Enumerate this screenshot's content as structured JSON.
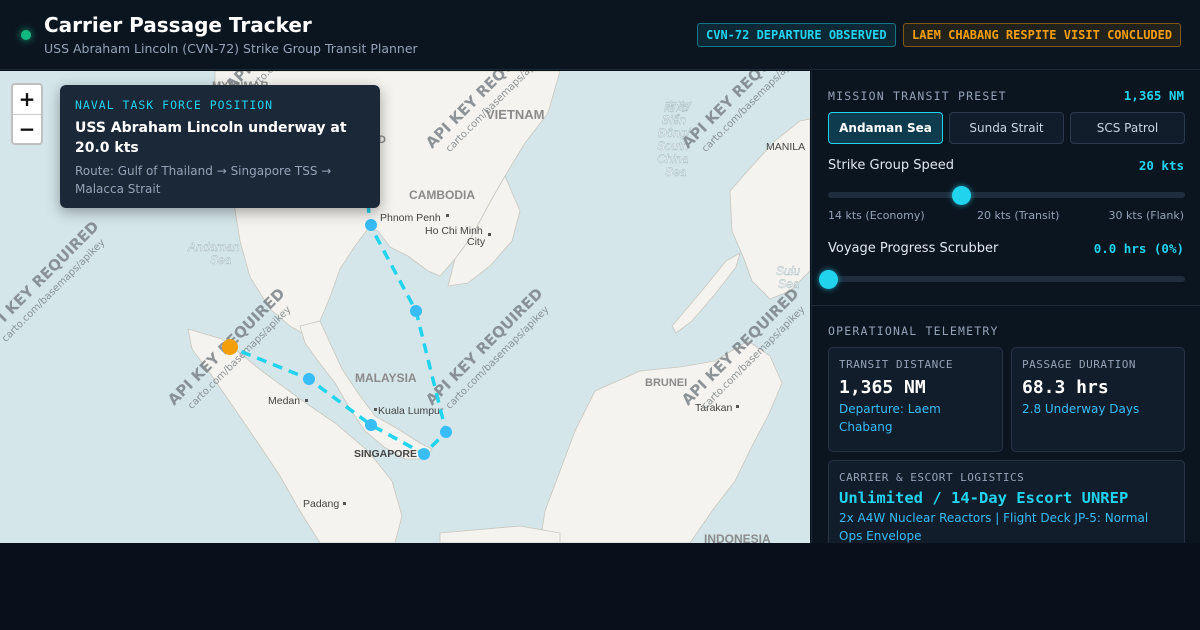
{
  "header": {
    "title": "Carrier Passage Tracker",
    "subtitle": "USS Abraham Lincoln (CVN-72) Strike Group Transit Planner",
    "badges": [
      {
        "label": "CVN-72 DEPARTURE OBSERVED",
        "color": "#22d3ee"
      },
      {
        "label": "LAEM CHABANG RESPITE VISIT CONCLUDED",
        "color": "#f59e0b"
      }
    ]
  },
  "map": {
    "zoom_in": "+",
    "zoom_out": "−",
    "labels": {
      "vietnam": "VIETNAM",
      "myanmar": "MYANMAR",
      "cambodia": "CAMBODIA",
      "phnom_penh": "Phnom Penh",
      "ho_chi_minh_1": "Ho Chi Minh",
      "ho_chi_minh_2": "City",
      "andaman_1": "Andaman",
      "andaman_2": "Sea",
      "malaysia": "MALAYSIA",
      "medan": "Medan",
      "kuala_lumpur": "Kuala Lumpur",
      "singapore": "SINGAPORE",
      "padang": "Padang",
      "brunei": "BRUNEI",
      "tarakan": "Tarakan",
      "indonesia": "INDONESIA",
      "manila": "MANILA",
      "scs_1": "南海/",
      "scs_2": "Biển",
      "scs_3": "Đông/",
      "scs_4": "South",
      "scs_5": "China",
      "scs_6": "Sea",
      "sulu_1": "Sulu",
      "sulu_2": "Sea",
      "d_fragment": "D"
    },
    "watermark_text": "API KEY REQUIRED",
    "watermark_sub": "carto.com/basemaps/apikey",
    "popup": {
      "kicker": "NAVAL TASK FORCE POSITION",
      "title": "USS Abraham Lincoln underway at 20.0 kts",
      "route": "Route: Gulf of Thailand → Singapore TSS → Malacca Strait"
    },
    "colors": {
      "route": "#22d3ee",
      "waypoint": "#38bdf8",
      "carrier": "#f59e0b",
      "water": "#d4e6ea",
      "land": "#f4f3ef"
    }
  },
  "panel": {
    "preset": {
      "label": "MISSION TRANSIT PRESET",
      "distance": "1,365 NM",
      "options": [
        "Andaman Sea",
        "Sunda Strait",
        "SCS Patrol"
      ],
      "active": "Andaman Sea"
    },
    "speed": {
      "label": "Strike Group Speed",
      "value": "20 kts",
      "min_kts": 14,
      "max_kts": 30,
      "current_kts": 20,
      "ticks": [
        "14 kts (Economy)",
        "20 kts (Transit)",
        "30 kts (Flank)"
      ]
    },
    "progress": {
      "label": "Voyage Progress Scrubber",
      "value": "0.0 hrs (0%)",
      "fraction": 0
    },
    "telemetry": {
      "label": "OPERATIONAL TELEMETRY",
      "distance": {
        "title": "TRANSIT DISTANCE",
        "value": "1,365 NM",
        "sub": "Departure: Laem Chabang"
      },
      "duration": {
        "title": "PASSAGE DURATION",
        "value": "68.3 hrs",
        "sub": "2.8 Underway Days"
      },
      "logistics": {
        "title": "CARRIER & ESCORT LOGISTICS",
        "value": "Unlimited / 14-Day Escort UNREP",
        "sub": "2x A4W Nuclear Reactors | Flight Deck JP-5: Normal Ops Envelope"
      }
    }
  }
}
